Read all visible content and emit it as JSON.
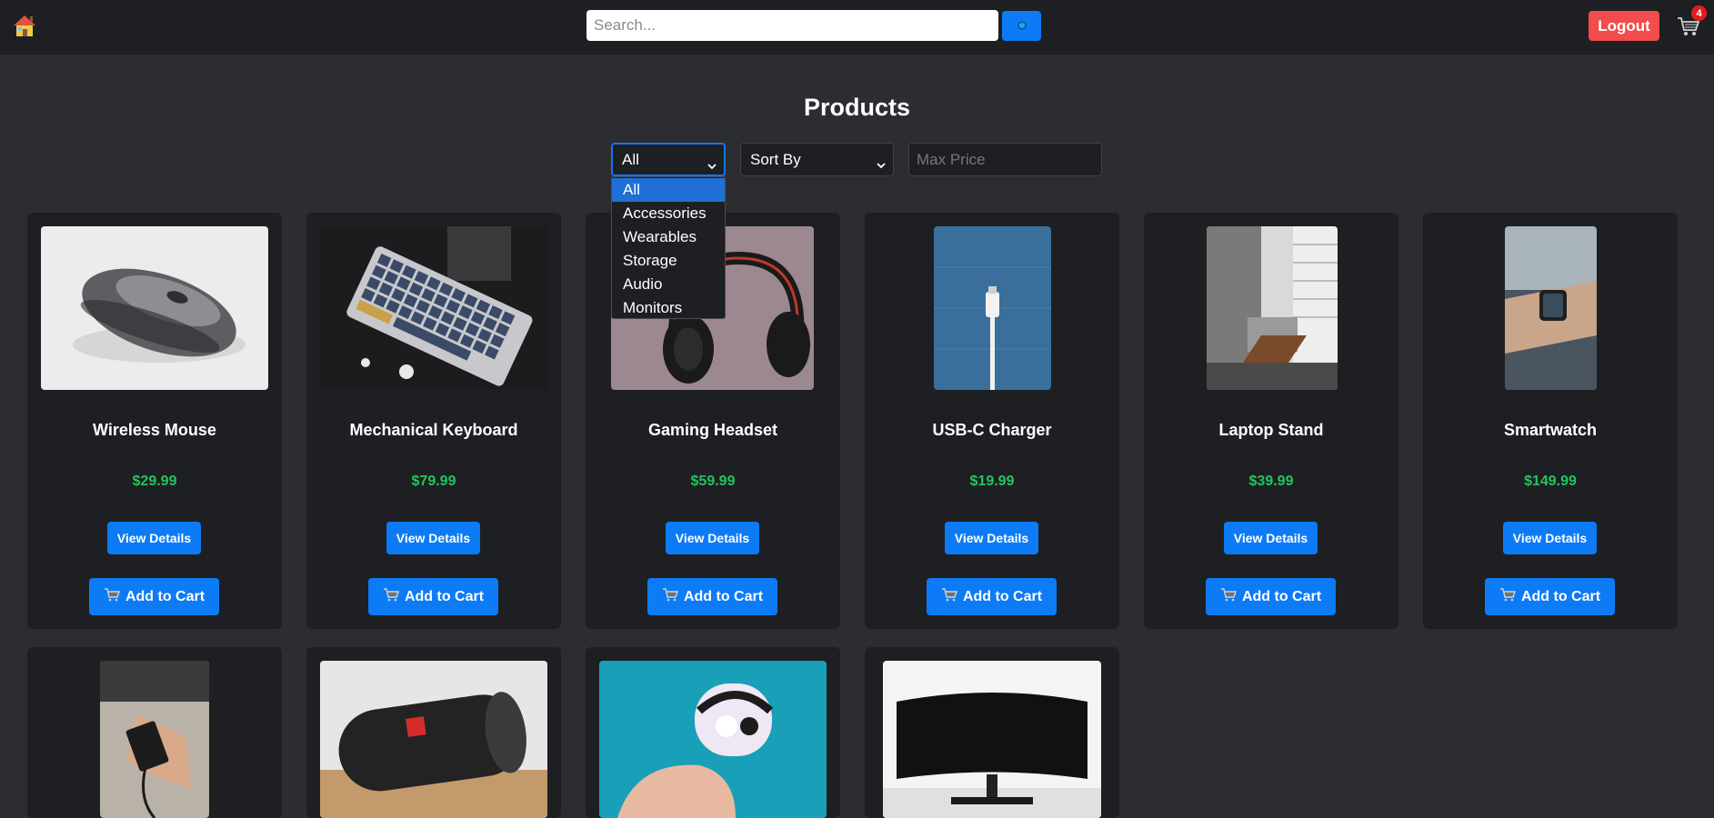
{
  "navbar": {
    "home_icon": "house-icon",
    "search_placeholder": "Search...",
    "search_icon": "globe-icon",
    "logout_label": "Logout",
    "cart_icon": "shopping-cart-icon",
    "cart_count": "4"
  },
  "page": {
    "title": "Products"
  },
  "filters": {
    "category_selected": "All",
    "category_options": [
      "All",
      "Accessories",
      "Wearables",
      "Storage",
      "Audio",
      "Monitors"
    ],
    "sort_selected": "Sort By",
    "max_price_placeholder": "Max Price"
  },
  "products": [
    {
      "name": "Wireless Mouse",
      "price": "$29.99",
      "details_label": "View Details",
      "cart_label": "Add to Cart"
    },
    {
      "name": "Mechanical Keyboard",
      "price": "$79.99",
      "details_label": "View Details",
      "cart_label": "Add to Cart"
    },
    {
      "name": "Gaming Headset",
      "price": "$59.99",
      "details_label": "View Details",
      "cart_label": "Add to Cart"
    },
    {
      "name": "USB-C Charger",
      "price": "$19.99",
      "details_label": "View Details",
      "cart_label": "Add to Cart"
    },
    {
      "name": "Laptop Stand",
      "price": "$39.99",
      "details_label": "View Details",
      "cart_label": "Add to Cart"
    },
    {
      "name": "Smartwatch",
      "price": "$149.99",
      "details_label": "View Details",
      "cart_label": "Add to Cart"
    }
  ],
  "colors": {
    "accent": "#0d7bf5",
    "logout": "#f24c4c",
    "price": "#22c55e",
    "badge": "#e11d1d"
  }
}
